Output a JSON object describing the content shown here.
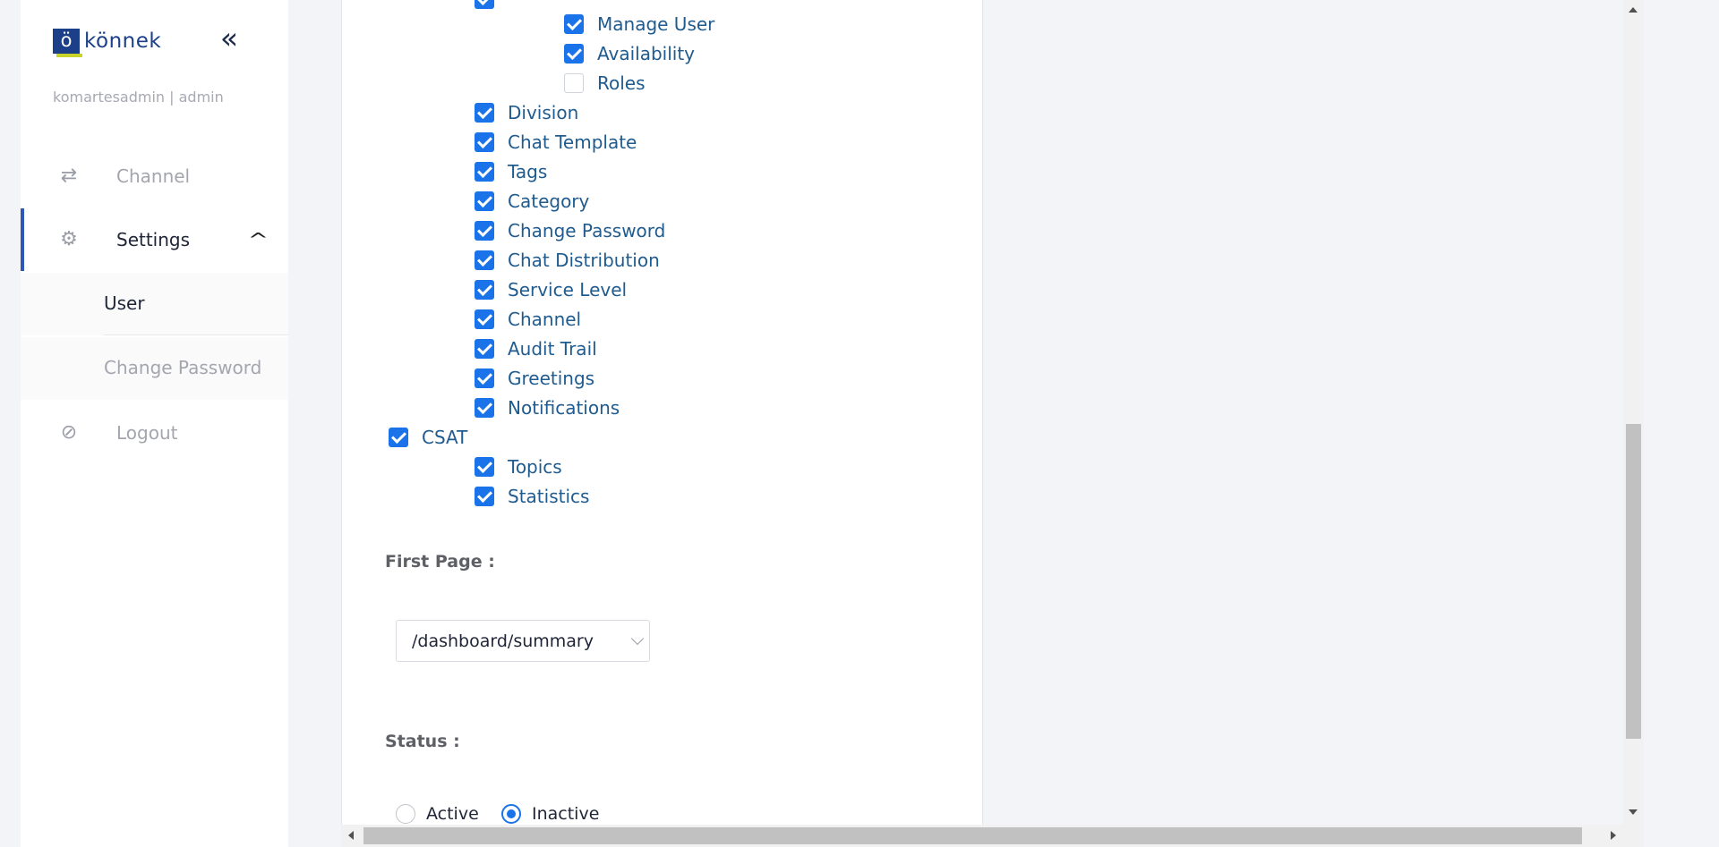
{
  "app": {
    "logo_mark": "ö",
    "logo_text": "könnek",
    "user": "komartesadmin | admin",
    "collapse_glyph": "«"
  },
  "sidebar": {
    "channel": "Channel",
    "settings": "Settings",
    "user": "User",
    "change_password": "Change Password",
    "logout": "Logout"
  },
  "permissions": {
    "manage_user": "Manage User",
    "availability": "Availability",
    "roles": "Roles",
    "division": "Division",
    "chat_template": "Chat Template",
    "tags": "Tags",
    "category": "Category",
    "change_password": "Change Password",
    "chat_distribution": "Chat Distribution",
    "service_level": "Service Level",
    "channel": "Channel",
    "audit_trail": "Audit Trail",
    "greetings": "Greetings",
    "notifications": "Notifications",
    "csat": "CSAT",
    "topics": "Topics",
    "statistics": "Statistics"
  },
  "form": {
    "first_page_label": "First Page :",
    "first_page_value": "/dashboard/summary",
    "status_label": "Status :",
    "status_active": "Active",
    "status_inactive": "Inactive"
  },
  "colors": {
    "accent": "#1a73e8",
    "brand": "#1c3f8a",
    "label_text": "#1f5b8f"
  }
}
